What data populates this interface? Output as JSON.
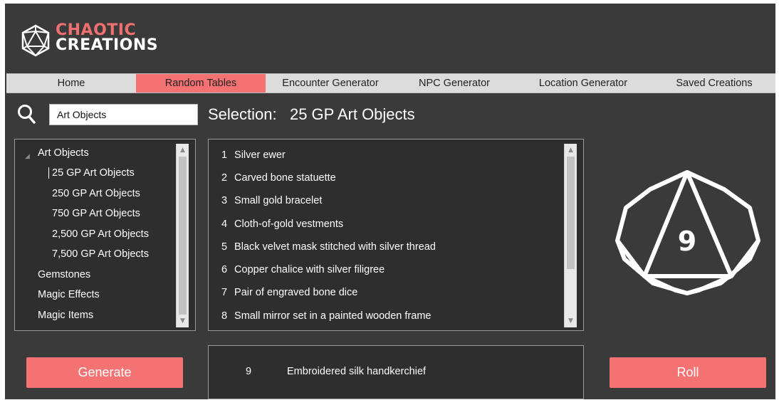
{
  "app": {
    "logo_line1": "CHAOTIC",
    "logo_line2": "CREATIONS"
  },
  "nav": {
    "tabs": [
      {
        "label": "Home"
      },
      {
        "label": "Random Tables",
        "active": true
      },
      {
        "label": "Encounter Generator"
      },
      {
        "label": "NPC Generator"
      },
      {
        "label": "Location Generator"
      },
      {
        "label": "Saved Creations"
      }
    ]
  },
  "search": {
    "value": "Art Objects",
    "icon": "search-icon"
  },
  "selection": {
    "prefix": "Selection:",
    "name": "25 GP Art Objects"
  },
  "tree": {
    "items": [
      {
        "label": "Art Objects"
      },
      {
        "label": "25 GP Art Objects",
        "selected": true
      },
      {
        "label": "250 GP Art Objects"
      },
      {
        "label": "750 GP Art Objects"
      },
      {
        "label": "2,500 GP Art Objects"
      },
      {
        "label": "7,500 GP Art Objects"
      },
      {
        "label": "Gemstones"
      },
      {
        "label": "Magic Effects"
      },
      {
        "label": "Magic Items"
      }
    ]
  },
  "table_rows": [
    {
      "num": "1",
      "text": "Silver ewer"
    },
    {
      "num": "2",
      "text": "Carved bone statuette"
    },
    {
      "num": "3",
      "text": "Small gold bracelet"
    },
    {
      "num": "4",
      "text": "Cloth-of-gold vestments"
    },
    {
      "num": "5",
      "text": "Black velvet mask stitched with silver thread"
    },
    {
      "num": "6",
      "text": "Copper chalice with silver filigree"
    },
    {
      "num": "7",
      "text": "Pair of engraved bone dice"
    },
    {
      "num": "8",
      "text": "Small mirror set in a painted wooden frame"
    }
  ],
  "die": {
    "value": "9",
    "icon": "d10-die-icon"
  },
  "buttons": {
    "generate": "Generate",
    "roll": "Roll"
  },
  "result": {
    "num": "9",
    "text": "Embroidered silk handkerchief"
  },
  "colors": {
    "accent": "#f47272",
    "background": "#3a3a3a",
    "panel": "#2e2e2e",
    "nav": "#dcdcdc"
  }
}
